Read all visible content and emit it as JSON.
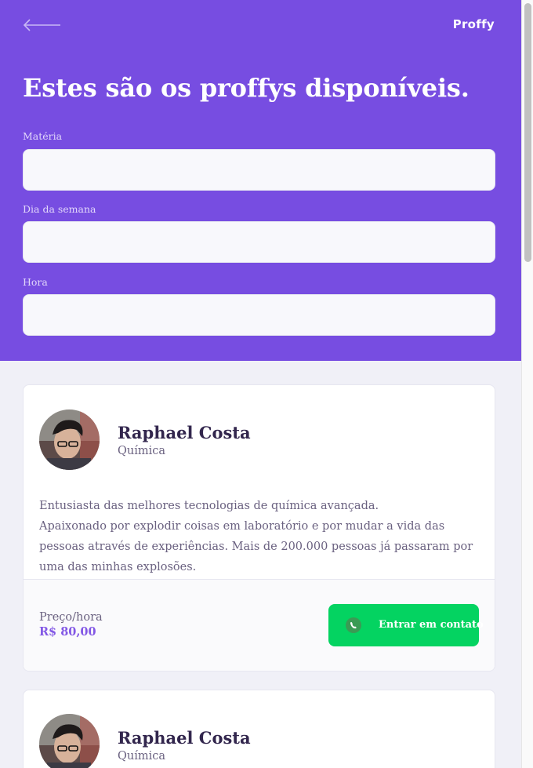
{
  "header": {
    "logo": "Proffy",
    "title": "Estes são os proffys disponíveis."
  },
  "filters": {
    "subject_label": "Matéria",
    "weekday_label": "Dia da semana",
    "time_label": "Hora"
  },
  "teachers": [
    {
      "name": "Raphael Costa",
      "subject": "Química",
      "bio_line1": "Entusiasta das melhores tecnologias de química avançada.",
      "bio_line2": "Apaixonado por explodir coisas em laboratório e por mudar a vida das pessoas através de experiências. Mais de 200.000 pessoas já passaram por uma das minhas explosões.",
      "price_label": "Preço/hora",
      "price": "R$ 80,00",
      "contact_label": "Entrar em contato"
    },
    {
      "name": "Raphael Costa",
      "subject": "Química"
    }
  ],
  "colors": {
    "primary": "#774DE1",
    "accent": "#8257E5",
    "success": "#04D361",
    "background": "#F0F0F7"
  }
}
